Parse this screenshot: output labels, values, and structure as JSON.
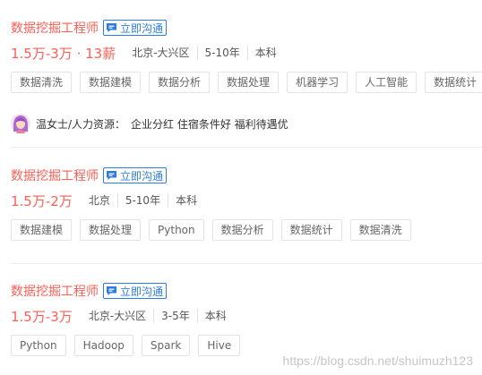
{
  "chat_label": "立即沟通",
  "jobs": [
    {
      "title": "数据挖掘工程师",
      "salary": "1.5万-3万 · 13薪",
      "location": "北京-大兴区",
      "experience": "5-10年",
      "education": "本科",
      "tags": [
        "数据清洗",
        "数据建模",
        "数据分析",
        "数据处理",
        "机器学习",
        "人工智能",
        "数据统计"
      ]
    },
    {
      "title": "数据挖掘工程师",
      "salary": "1.5万-2万",
      "location": "北京",
      "experience": "5-10年",
      "education": "本科",
      "tags": [
        "数据建模",
        "数据处理",
        "Python",
        "数据分析",
        "数据统计",
        "数据清洗"
      ]
    },
    {
      "title": "数据挖掘工程师",
      "salary": "1.5万-3万",
      "location": "北京-大兴区",
      "experience": "3-5年",
      "education": "本科",
      "tags": [
        "Python",
        "Hadoop",
        "Spark",
        "Hive"
      ]
    }
  ],
  "recruiter": {
    "name": "温女士/人力资源：",
    "benefits": "企业分红 住宿条件好 福利待遇优"
  },
  "watermark": "https://blog.csdn.net/shuimuzh123",
  "colors": {
    "title": "#fd5f55",
    "salary": "#fd5f55",
    "chat_button": "#2f7ce0"
  }
}
